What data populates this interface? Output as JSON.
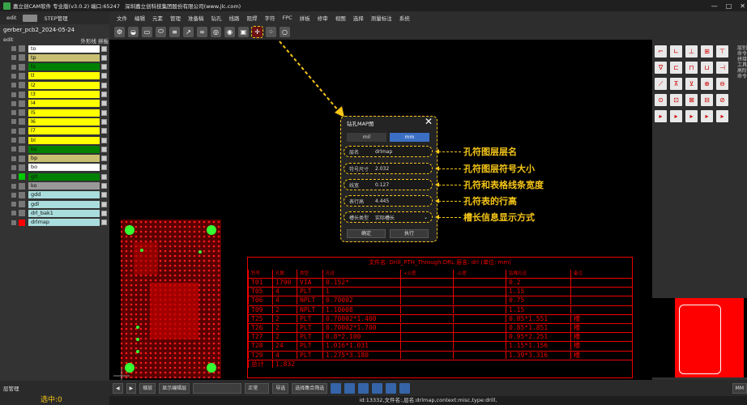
{
  "titlebar": {
    "app": "嘉立创CAM软件 专业版(v3.0.2) 端口:65247",
    "company": "深圳嘉立创科技集团股份有限公司(www.jlc.com)"
  },
  "left": {
    "tab_edit": "edit",
    "tab_step": "STEP管理",
    "file": "gerber_pcb2_2024-05-24",
    "edit_label": "edit",
    "outline": "外形线",
    "panel": "拼板",
    "layers": [
      {
        "name": "to",
        "color": "#ffffff",
        "swatch": "#777777"
      },
      {
        "name": "tp",
        "color": "#c8c070",
        "swatch": "#777777"
      },
      {
        "name": "ts",
        "color": "#008000",
        "swatch": "#777777"
      },
      {
        "name": "tl",
        "color": "#ffff00",
        "swatch": "#777777"
      },
      {
        "name": "l2",
        "color": "#ffff00",
        "swatch": "#777777"
      },
      {
        "name": "l3",
        "color": "#ffff00",
        "swatch": "#777777"
      },
      {
        "name": "l4",
        "color": "#ffff00",
        "swatch": "#777777"
      },
      {
        "name": "l5",
        "color": "#ffff00",
        "swatch": "#777777"
      },
      {
        "name": "l6",
        "color": "#ffff00",
        "swatch": "#777777"
      },
      {
        "name": "l7",
        "color": "#ffff00",
        "swatch": "#777777"
      },
      {
        "name": "bl",
        "color": "#ffff00",
        "swatch": "#777777"
      },
      {
        "name": "bs",
        "color": "#008000",
        "swatch": "#777777"
      },
      {
        "name": "bp",
        "color": "#c8c070",
        "swatch": "#777777"
      },
      {
        "name": "bo",
        "color": "#ffffff",
        "swatch": "#777777"
      },
      {
        "name": "gtl",
        "color": "#008000",
        "swatch": "#00cc00"
      },
      {
        "name": "ko",
        "color": "#999999",
        "swatch": "#777777"
      },
      {
        "name": "gdd",
        "color": "#aadddd",
        "swatch": "#777777"
      },
      {
        "name": "gdl",
        "color": "#aadddd",
        "swatch": "#777777"
      },
      {
        "name": "drl_bak1",
        "color": "#aadddd",
        "swatch": "#777777"
      },
      {
        "name": "drlmap",
        "color": "#aadddd",
        "swatch": "#ff0000"
      }
    ],
    "layer_manager": "层管理",
    "selected": "选中:0"
  },
  "menu": [
    "文件",
    "编辑",
    "元素",
    "管理",
    "准备稿",
    "钻孔",
    "线路",
    "阻焊",
    "字符",
    "FPC",
    "拼板",
    "修审",
    "视图",
    "选择",
    "测量标注",
    "系统"
  ],
  "dialog": {
    "title": "钻孔MAP图",
    "unit_mil": "mil",
    "unit_mm": "mm",
    "layer_label": "层名",
    "layer_value": "drlmap",
    "size_label": "符号尺寸",
    "size_value": "2.032",
    "width_label": "线宽",
    "width_value": "0.127",
    "row_label": "表行高",
    "row_value": "4.445",
    "slot_label": "槽长类型",
    "slot_value": "实际槽长",
    "ok": "确定",
    "run": "执行"
  },
  "annotations": [
    "孔符图层层名",
    "孔符图层符号大小",
    "孔符和表格线条宽度",
    "孔符表的行高",
    "槽长信息显示方式"
  ],
  "table": {
    "title": "文件名: Drill_PTH_Through.DRL   层名: drl  (单位: mm)",
    "headers": [
      "符号",
      "孔数",
      "类型",
      "孔径",
      "+公差",
      "-公差",
      "钻嘴孔径",
      "备注"
    ],
    "rows": [
      [
        "T01",
        "1790",
        "VIA",
        "0.152*",
        "",
        "",
        "0.2",
        ""
      ],
      [
        "T05",
        "4",
        "PLT",
        "1",
        "",
        "",
        "1.15",
        ""
      ],
      [
        "T06",
        "4",
        "NPLT",
        "0.70002",
        "",
        "",
        "0.75",
        ""
      ],
      [
        "T09",
        "2",
        "NPLT",
        "1.10008",
        "",
        "",
        "1.15",
        ""
      ],
      [
        "T25",
        "2",
        "PLT",
        "0.70002*1.400",
        "",
        "",
        "0.85*1.551",
        "槽"
      ],
      [
        "T26",
        "2",
        "PLT",
        "0.70002*1.700",
        "",
        "",
        "0.85*1.851",
        "槽"
      ],
      [
        "T27",
        "2",
        "PLT",
        "0.8*2.100",
        "",
        "",
        "0.95*2.251",
        "槽"
      ],
      [
        "T28",
        "24",
        "PLT",
        "1.016*1.031",
        "",
        "",
        "1.15*1.156",
        "槽"
      ],
      [
        "T29",
        "4",
        "PLT",
        "1.275*3.180",
        "",
        "",
        "1.39*3.316",
        "槽"
      ]
    ],
    "total_label": "总计",
    "total": "1,832"
  },
  "bottom": {
    "zoom": "缩放",
    "show_name": "显示编辑层",
    "mode": "正常",
    "select": "导选",
    "select_all": "选择集合筛选",
    "unit": "MM"
  },
  "status": "id:13332,文件名:,层名:drlmap,context:misc,type:drill,",
  "rightvtabs": "层别命令 拼接工具 高阶命令"
}
